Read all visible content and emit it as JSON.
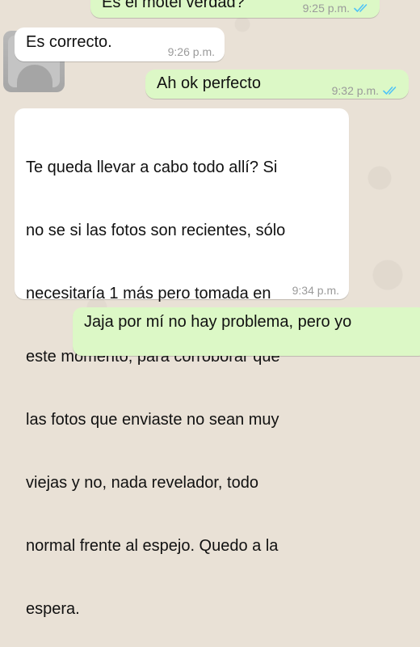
{
  "chat": {
    "messages": [
      {
        "direction": "outgoing",
        "text": "Es el motel verdad?",
        "time": "9:25 p.m.",
        "status": "read"
      },
      {
        "direction": "incoming",
        "text": "Es correcto.",
        "time": "9:26 p.m."
      },
      {
        "direction": "outgoing",
        "text": "Ah ok perfecto",
        "time": "9:32 p.m.",
        "status": "read"
      },
      {
        "direction": "incoming",
        "lines": [
          "Te queda llevar a cabo todo allí? Si",
          "no se si las fotos son recientes, sólo",
          "necesitaría 1 más pero tomada en",
          "este momento, para corroborar que",
          "las fotos que enviaste no sean muy",
          "viejas y no, nada revelador, todo",
          "normal frente al espejo. Quedo a la",
          "espera."
        ],
        "time": "9:34 p.m."
      },
      {
        "direction": "outgoing",
        "text": "Jaja por mí no hay problema, pero yo",
        "time": ""
      }
    ]
  },
  "colors": {
    "outgoing_bubble": "#dcf8c6",
    "incoming_bubble": "#ffffff",
    "read_ticks": "#4fc3f7",
    "timestamp": "#9a9a9a",
    "wallpaper": "#e9e1d6"
  },
  "icons": {
    "read_receipt": "double-check-icon",
    "contact_avatar": "default-contact-avatar"
  }
}
